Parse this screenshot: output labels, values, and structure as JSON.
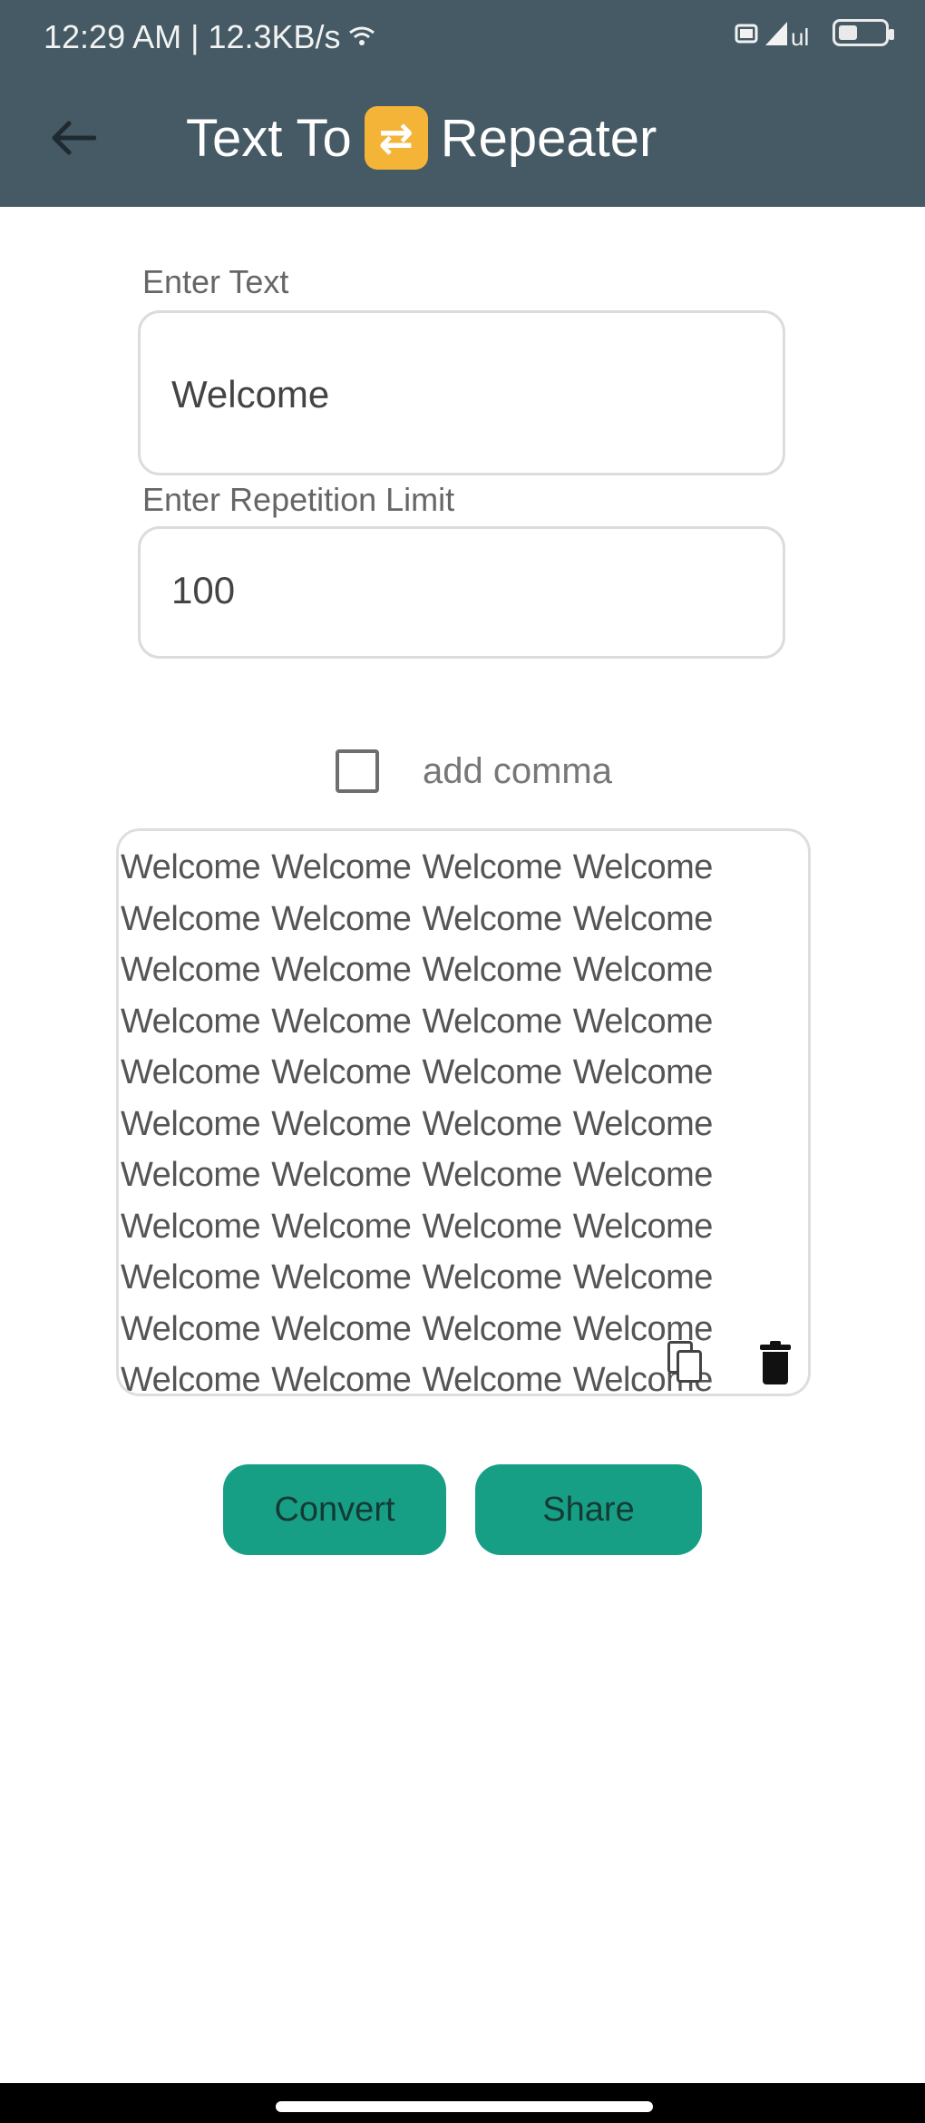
{
  "status": {
    "time_speed": "12:29 AM | 12.3KB/s",
    "signal": "📶",
    "battery": "🔋"
  },
  "header": {
    "back_icon": "arrow-left-icon",
    "title_before": "Text To",
    "title_icon": "repeat-icon",
    "title_after": "Repeater",
    "title_icon_glyph": "⇄",
    "color": "#455a64"
  },
  "form": {
    "text_label": "Enter Text",
    "text_value": "Welcome",
    "limit_label": "Enter Repetition Limit",
    "limit_value": "100",
    "comma_label": "add comma"
  },
  "output": {
    "repeated_word": "Welcome",
    "repeat_count": 100,
    "copy_icon": "copy-icon",
    "delete_icon": "trash-icon"
  },
  "buttons": {
    "convert": "Convert",
    "share": "Share",
    "color": "#179f86"
  }
}
